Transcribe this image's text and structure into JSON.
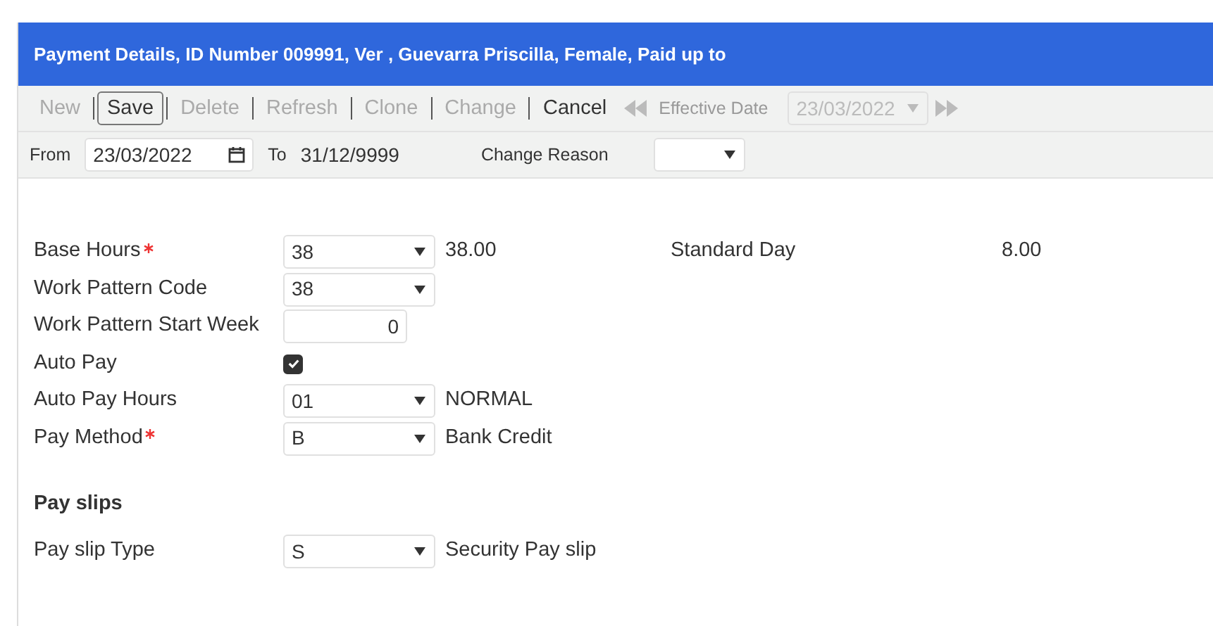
{
  "header": {
    "title": "Payment Details, ID Number 009991, Ver , Guevarra Priscilla, Female, Paid up to"
  },
  "toolbar": {
    "buttons": [
      {
        "label": "New",
        "disabled": true,
        "focused": false
      },
      {
        "label": "Save",
        "disabled": false,
        "focused": true
      },
      {
        "label": "Delete",
        "disabled": true,
        "focused": false
      },
      {
        "label": "Refresh",
        "disabled": true,
        "focused": false
      },
      {
        "label": "Clone",
        "disabled": true,
        "focused": false
      },
      {
        "label": "Change",
        "disabled": true,
        "focused": false
      },
      {
        "label": "Cancel",
        "disabled": false,
        "focused": false
      }
    ],
    "effective_date": {
      "label": "Effective Date",
      "value": "23/03/2022",
      "disabled": true
    }
  },
  "filter": {
    "from_label": "From",
    "from_value": "23/03/2022",
    "to_label": "To",
    "to_value": "31/12/9999",
    "reason_label": "Change Reason"
  },
  "fields": [
    {
      "kind": "select",
      "label": "Base Hours",
      "required": true,
      "value": "38",
      "description": "38.00",
      "extra_label": "Standard Day",
      "extra_value": "8.00"
    },
    {
      "kind": "select",
      "label": "Work Pattern Code",
      "required": false,
      "value": "38"
    },
    {
      "kind": "number",
      "label": "Work Pattern Start Week",
      "required": false,
      "value": "0"
    },
    {
      "kind": "checkbox",
      "label": "Auto Pay",
      "required": false,
      "checked": true
    },
    {
      "kind": "select",
      "label": "Auto Pay Hours",
      "required": false,
      "value": "01",
      "description": "NORMAL"
    },
    {
      "kind": "select",
      "label": "Pay Method",
      "required": true,
      "value": "B",
      "description": "Bank Credit"
    }
  ],
  "payslips": {
    "heading": "Pay slips",
    "fields": [
      {
        "kind": "select",
        "label": "Pay slip Type",
        "required": false,
        "value": "S",
        "description": "Security Pay slip"
      }
    ]
  }
}
